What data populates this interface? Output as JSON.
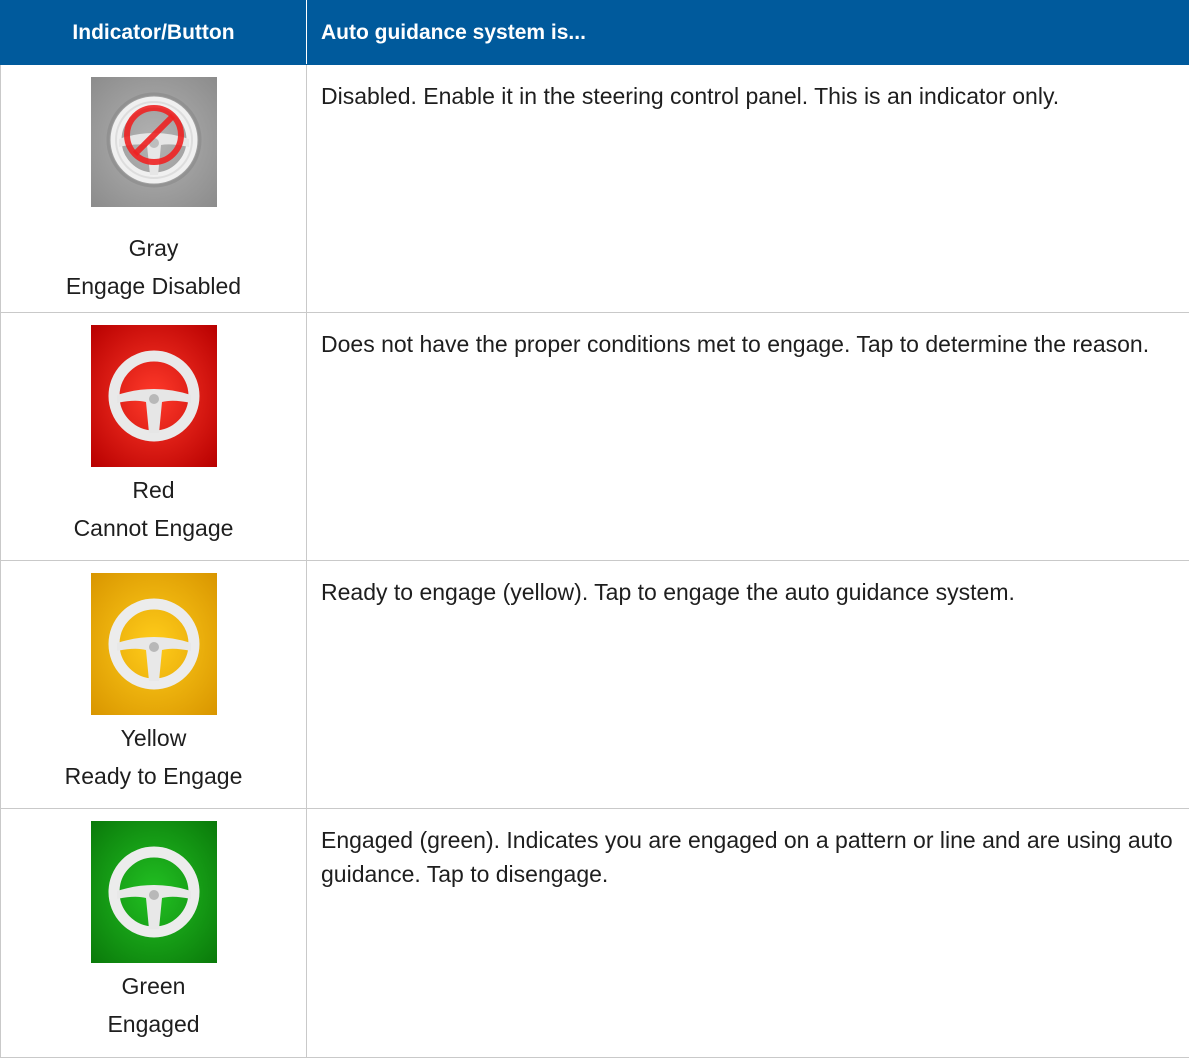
{
  "header": {
    "col1": "Indicator/Button",
    "col2": "Auto guidance system is..."
  },
  "rows": [
    {
      "color_name": "Gray",
      "status": "Engage Disabled",
      "description": "Disabled. Enable it in the steering control panel. This is an indicator only.",
      "icon": "steering-wheel-disabled-icon",
      "bg_color": "#9a9a9a",
      "interactable": false
    },
    {
      "color_name": "Red",
      "status": "Cannot Engage",
      "description": "Does not have the proper conditions met to engage. Tap to determine the reason.",
      "icon": "steering-wheel-icon",
      "bg_color": "#e10000",
      "interactable": true
    },
    {
      "color_name": "Yellow",
      "status": "Ready to Engage",
      "description": "Ready to engage (yellow). Tap to engage the auto guidance system.",
      "icon": "steering-wheel-icon",
      "bg_color": "#f2b400",
      "interactable": true
    },
    {
      "color_name": "Green",
      "status": "Engaged",
      "description": "Engaged (green). Indicates you are engaged on a pattern or line and are using auto guidance. Tap to disengage.",
      "icon": "steering-wheel-icon",
      "bg_color": "#139a13",
      "interactable": true
    }
  ]
}
